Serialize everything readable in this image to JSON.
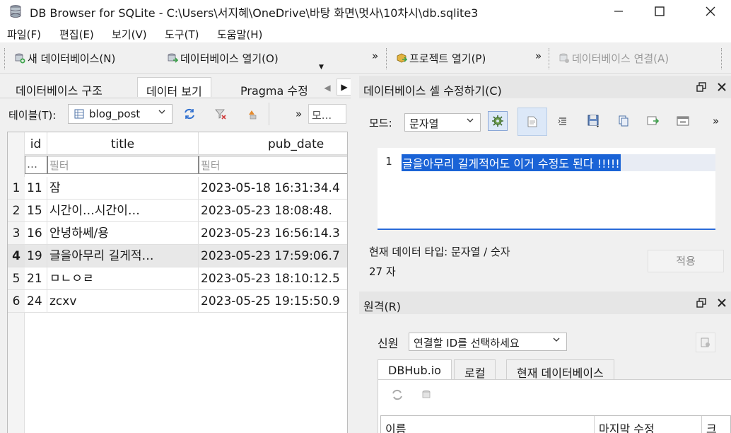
{
  "window": {
    "title": "DB Browser for SQLite - C:\\Users\\서지혜\\OneDrive\\바탕 화면\\멋사\\10차시\\db.sqlite3",
    "app_icon": "database-icon",
    "minimize": "—",
    "maximize": "☐",
    "close": "✕"
  },
  "menu": {
    "items": [
      "파일(F)",
      "편집(E)",
      "보기(V)",
      "도구(T)",
      "도움말(H)"
    ]
  },
  "toolbar": {
    "new_db": "새 데이터베이스(N)",
    "open_db": "데이터베이스 열기(O)",
    "open_project": "프로젝트 열기(P)",
    "attach_db": "데이터베이스 연결(A)",
    "overflow": "»"
  },
  "left_tabs": [
    "데이터베이스 구조",
    "데이터 보기",
    "Pragma 수정"
  ],
  "browse": {
    "table_label": "테이블(T):",
    "table_selected": "blog_post",
    "filter_placeholder": "모...",
    "overflow": "»"
  },
  "grid": {
    "columns": [
      "id",
      "title",
      "pub_date"
    ],
    "filter_row": [
      "…",
      "필터",
      "필터"
    ],
    "rows": [
      {
        "num": "1",
        "id": "11",
        "title": "잠",
        "pub_date": "2023-05-18 16:31:34.4"
      },
      {
        "num": "2",
        "id": "15",
        "title": "시간이…시간이…",
        "pub_date": "2023-05-23 18:08:48."
      },
      {
        "num": "3",
        "id": "16",
        "title": "안녕하쎄/용",
        "pub_date": "2023-05-23 16:56:14.3"
      },
      {
        "num": "4",
        "id": "19",
        "title": "글을아무리 길게적…",
        "pub_date": "2023-05-23 17:59:06.7"
      },
      {
        "num": "5",
        "id": "21",
        "title": "ㅁㄴㅇㄹ",
        "pub_date": "2023-05-23 18:10:12.5"
      },
      {
        "num": "6",
        "id": "24",
        "title": "zcxv",
        "pub_date": "2023-05-25 19:15:50.9"
      }
    ],
    "selected_row_index": 3
  },
  "edit_cell": {
    "title": "데이터베이스 셀 수정하기(C)",
    "mode_label": "모드:",
    "mode_selected": "문자열",
    "line_number": "1",
    "content": "글을아무리 길게적어도 이거 수정도 된다 !!!!!",
    "type_info": "현재 데이터 타입: 문자열 / 숫자",
    "size_info": "27 자",
    "apply": "적용",
    "overflow": "»"
  },
  "remote": {
    "title": "원격(R)",
    "identity_label": "신원",
    "identity_selected": "연결할 ID를 선택하세요",
    "tabs": [
      "DBHub.io",
      "로컬",
      "현재 데이터베이스"
    ],
    "list_columns": [
      "이름",
      "마지막 수정",
      "크"
    ]
  },
  "colors": {
    "selection": "#1a63d6",
    "selected_row": "#e8e8e8",
    "dock_title": "#e6e6e6"
  }
}
